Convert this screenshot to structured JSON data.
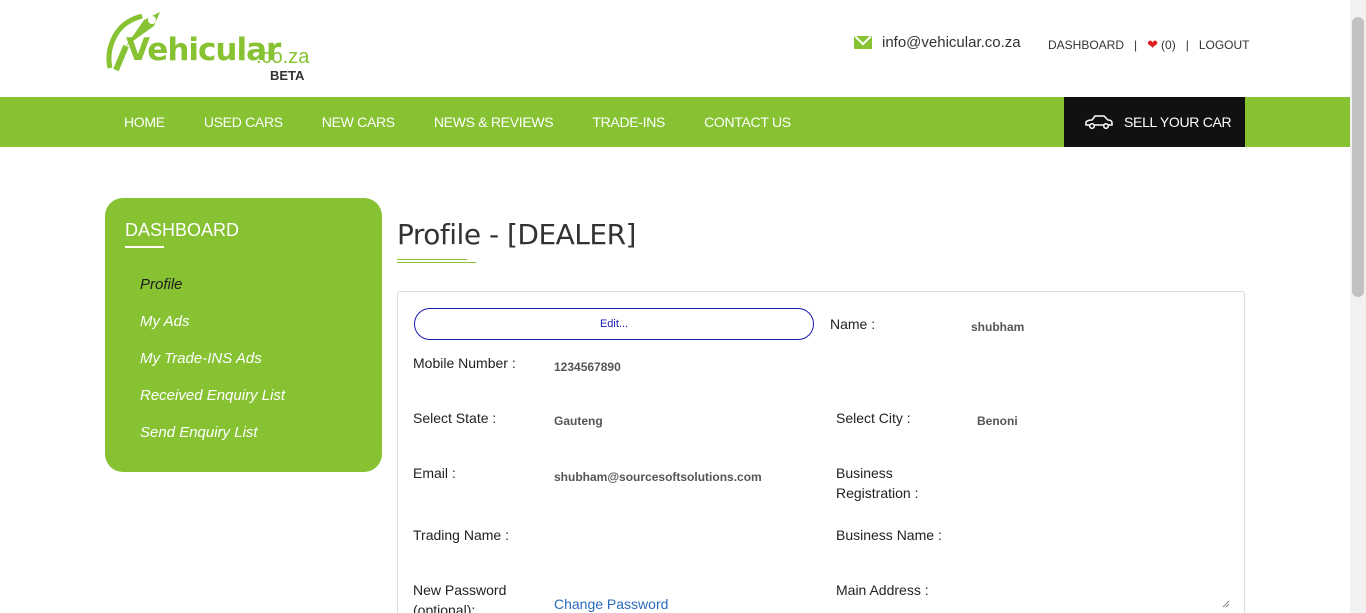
{
  "header": {
    "logo": {
      "brand": "Vehicular",
      "domain": ".co.za",
      "tag": "BETA"
    },
    "contact_email": "info@vehicular.co.za",
    "links": {
      "dashboard": "DASHBOARD",
      "wishlist_count": "(0)",
      "logout": "LOGOUT"
    }
  },
  "nav": {
    "items": [
      "HOME",
      "USED CARS",
      "NEW CARS",
      "NEWS & REVIEWS",
      "TRADE-INS",
      "CONTACT US"
    ],
    "sell_label": "SELL YOUR CAR"
  },
  "sidebar": {
    "title": "DASHBOARD",
    "items": [
      "Profile",
      "My Ads",
      "My Trade-INS Ads",
      "Received Enquiry List",
      "Send Enquiry List"
    ]
  },
  "main": {
    "title": "Profile - [DEALER]",
    "edit_label": "Edit...",
    "fields": {
      "name_label": "Name :",
      "name_value": "shubham",
      "mobile_label": "Mobile Number :",
      "mobile_value": "1234567890",
      "state_label": "Select State :",
      "state_value": "Gauteng",
      "city_label": "Select City :",
      "city_value": "Benoni",
      "email_label": "Email :",
      "email_value": "shubham@sourcesoftsolutions.com",
      "business_reg_label": "Business Registration :",
      "trading_label": "Trading Name :",
      "business_name_label": "Business Name :",
      "password_label": "New Password (optional):",
      "change_password": "Change Password",
      "address_label": "Main Address :"
    }
  },
  "colors": {
    "brand_green": "#86c232",
    "dark": "#111111",
    "link": "#2a6bbf",
    "edit_border": "#1a1ab0"
  }
}
